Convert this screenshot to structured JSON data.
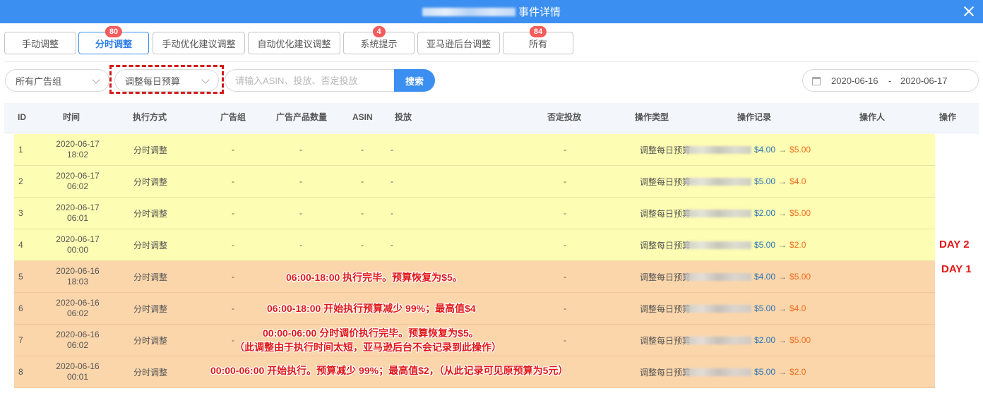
{
  "dialog": {
    "title": "事件详情"
  },
  "tabs": [
    {
      "label": "手动调整",
      "badge": ""
    },
    {
      "label": "分时调整",
      "badge": "80"
    },
    {
      "label": "手动优化建议调整",
      "badge": ""
    },
    {
      "label": "自动优化建议调整",
      "badge": ""
    },
    {
      "label": "系统提示",
      "badge": "4"
    },
    {
      "label": "亚马逊后台调整",
      "badge": ""
    },
    {
      "label": "所有",
      "badge": "84"
    }
  ],
  "filters": {
    "ad_group": "所有广告组",
    "op_type": "调整每日预算",
    "search_placeholder": "请输入ASIN、投放、否定投放",
    "search_button": "搜索",
    "date_from": "2020-06-16",
    "date_sep": "-",
    "date_to": "2020-06-17"
  },
  "columns": {
    "id": "ID",
    "time": "时间",
    "method": "执行方式",
    "ad_group": "广告组",
    "product_count": "广告产品数量",
    "asin": "ASIN",
    "targeting": "投放",
    "negative": "否定投放",
    "op_type": "操作类型",
    "record": "操作记录",
    "operator": "操作人",
    "action": "操作"
  },
  "rows": [
    {
      "id": "1",
      "date": "2020-06-17",
      "time": "18:02",
      "method": "分时调整",
      "ad_group": "-",
      "product_count": "-",
      "asin": "-",
      "targeting": "-",
      "negative": "-",
      "op_type": "调整每日预算",
      "from": "$4.00",
      "arrow": "→",
      "to": "$5.00"
    },
    {
      "id": "2",
      "date": "2020-06-17",
      "time": "06:02",
      "method": "分时调整",
      "ad_group": "-",
      "product_count": "-",
      "asin": "-",
      "targeting": "-",
      "negative": "-",
      "op_type": "调整每日预算",
      "from": "$5.00",
      "arrow": "→",
      "to": "$4.0"
    },
    {
      "id": "3",
      "date": "2020-06-17",
      "time": "06:01",
      "method": "分时调整",
      "ad_group": "-",
      "product_count": "-",
      "asin": "-",
      "targeting": "-",
      "negative": "-",
      "op_type": "调整每日预算",
      "from": "$2.00",
      "arrow": "→",
      "to": "$5.00"
    },
    {
      "id": "4",
      "date": "2020-06-17",
      "time": "00:00",
      "method": "分时调整",
      "ad_group": "-",
      "product_count": "-",
      "asin": "-",
      "targeting": "-",
      "negative": "-",
      "op_type": "调整每日预算",
      "from": "$5.00",
      "arrow": "→",
      "to": "$2.0"
    },
    {
      "id": "5",
      "date": "2020-06-16",
      "time": "18:03",
      "method": "分时调整",
      "ad_group": "-",
      "product_count": "",
      "asin": "",
      "targeting": "",
      "negative": "-",
      "op_type": "调整每日预算",
      "from": "$4.00",
      "arrow": "→",
      "to": "$5.00"
    },
    {
      "id": "6",
      "date": "2020-06-16",
      "time": "06:02",
      "method": "分时调整",
      "ad_group": "-",
      "product_count": "",
      "asin": "",
      "targeting": "",
      "negative": "-",
      "op_type": "调整每日预算",
      "from": "$5.00",
      "arrow": "→",
      "to": "$4.0"
    },
    {
      "id": "7",
      "date": "2020-06-16",
      "time": "06:02",
      "method": "分时调整",
      "ad_group": "-",
      "product_count": "",
      "asin": "",
      "targeting": "",
      "negative": "-",
      "op_type": "调整每日预算",
      "from": "$2.00",
      "arrow": "→",
      "to": "$5.00"
    },
    {
      "id": "8",
      "date": "2020-06-16",
      "time": "00:01",
      "method": "分时调整",
      "ad_group": "-",
      "product_count": "",
      "asin": "",
      "targeting": "",
      "negative": "",
      "op_type": "调整每日预算",
      "from": "$5.00",
      "arrow": "→",
      "to": "$2.0"
    }
  ],
  "annotations": {
    "day2": "DAY 2",
    "day1": "DAY 1",
    "row5": "06:00-18:00 执行完毕。预算恢复为$5。",
    "row6": "06:00-18:00 开始执行预算减少 99%；最高值$4",
    "row7_line1": "00:00-06:00 分时调价执行完毕。预算恢复为$5。",
    "row7_line2": "（此调整由于执行时间太短，亚马逊后台不会记录到此操作）",
    "row8": "00:00-06:00 开始执行。预算减少 99%；最高值$2，（从此记录可见原预算为5元）"
  },
  "colors": {
    "header_blue": "#3b8ff0",
    "day2_row": "#fdfdb3",
    "day1_row": "#fbd6ab",
    "annotation_red": "#e11818"
  }
}
